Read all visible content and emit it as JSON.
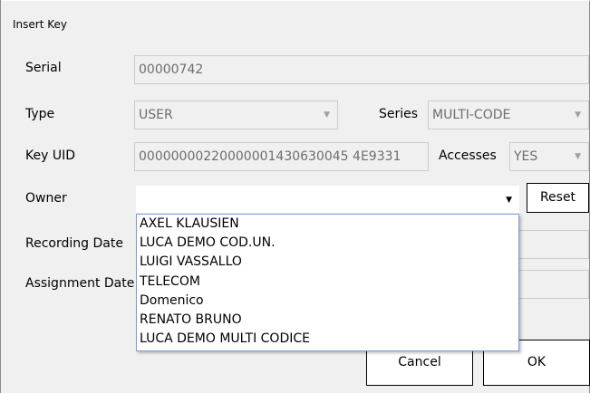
{
  "dialog": {
    "title": "Insert Key"
  },
  "labels": {
    "serial": "Serial",
    "type": "Type",
    "series": "Series",
    "key_uid": "Key UID",
    "accesses": "Accesses",
    "owner": "Owner",
    "recording_date": "Recording Date",
    "assignment_date": "Assignment Date"
  },
  "fields": {
    "serial": "00000742",
    "type": "USER",
    "series": "MULTI-CODE",
    "key_uid": "00000000220000001430630045 4E9331",
    "accesses": "YES",
    "owner": ""
  },
  "owner_options": [
    "AXEL KLAUSIEN",
    "LUCA DEMO COD.UN.",
    "LUIGI VASSALLO",
    "TELECOM",
    "Domenico",
    "RENATO BRUNO",
    "LUCA DEMO MULTI CODICE"
  ],
  "buttons": {
    "reset": "Reset",
    "cancel": "Cancel",
    "ok": "OK"
  },
  "icons": {
    "combo_arrow": "chevron-down-icon",
    "dropdown_arrow": "triangle-down-icon"
  }
}
